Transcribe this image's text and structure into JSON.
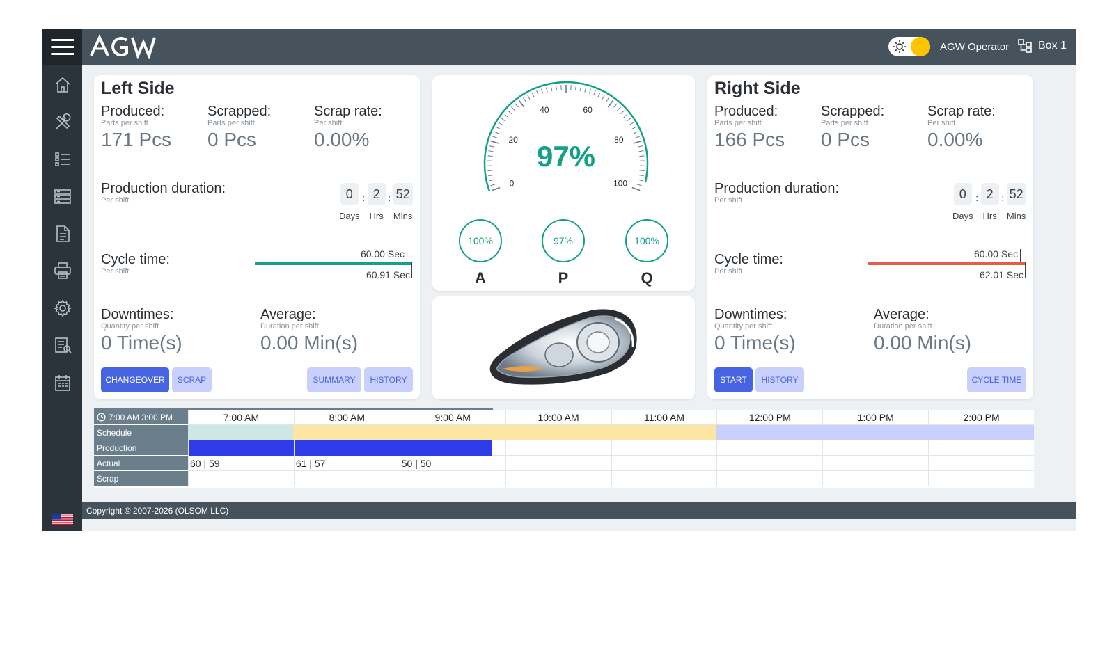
{
  "topbar": {
    "operator": "AGW Operator",
    "box": "Box 1"
  },
  "sidebar": {
    "items": [
      "home-icon",
      "tools-icon",
      "checklist-icon",
      "server-icon",
      "document-icon",
      "printer-icon",
      "gear-icon",
      "report-icon",
      "calendar-icon"
    ]
  },
  "left": {
    "title": "Left Side",
    "produced_label": "Produced:",
    "produced_sub": "Parts per shift",
    "produced_value": "171 Pcs",
    "scrapped_label": "Scrapped:",
    "scrapped_sub": "Parts per shift",
    "scrapped_value": "0 Pcs",
    "scrap_rate_label": "Scrap rate:",
    "scrap_rate_sub": "Per shift",
    "scrap_rate_value": "0.00%",
    "duration_label": "Production duration:",
    "duration_sub": "Per shift",
    "days": "0",
    "hrs": "2",
    "mins": "52",
    "days_cap": "Days",
    "hrs_cap": "Hrs",
    "mins_cap": "Mins",
    "cycle_label": "Cycle time:",
    "cycle_sub": "Per shift",
    "cycle_target": "60.00 Sec",
    "cycle_actual": "60.91 Sec",
    "cycle_color": "#14a08a",
    "downtimes_label": "Downtimes:",
    "downtimes_sub": "Quantity per shift",
    "downtimes_value": "0 Time(s)",
    "average_label": "Average:",
    "average_sub": "Duration per shift",
    "average_value": "0.00 Min(s)",
    "buttons": {
      "changeover": "CHANGEOVER",
      "scrap": "SCRAP",
      "summary": "SUMMARY",
      "history": "HISTORY"
    }
  },
  "right": {
    "title": "Right Side",
    "produced_label": "Produced:",
    "produced_sub": "Parts per shift",
    "produced_value": "166 Pcs",
    "scrapped_label": "Scrapped:",
    "scrapped_sub": "Parts per shift",
    "scrapped_value": "0 Pcs",
    "scrap_rate_label": "Scrap rate:",
    "scrap_rate_sub": "Per shift",
    "scrap_rate_value": "0.00%",
    "duration_label": "Production duration:",
    "duration_sub": "Per shift",
    "days": "0",
    "hrs": "2",
    "mins": "52",
    "days_cap": "Days",
    "hrs_cap": "Hrs",
    "mins_cap": "Mins",
    "cycle_label": "Cycle time:",
    "cycle_sub": "Per shift",
    "cycle_target": "60.00 Sec",
    "cycle_actual": "62.01 Sec",
    "cycle_color": "#ea5a4a",
    "downtimes_label": "Downtimes:",
    "downtimes_sub": "Quantity per shift",
    "downtimes_value": "0 Time(s)",
    "average_label": "Average:",
    "average_sub": "Duration per shift",
    "average_value": "0.00 Min(s)",
    "buttons": {
      "start": "START",
      "history": "HISTORY",
      "cycle_time": "CYCLE TIME"
    }
  },
  "gauge": {
    "value": "97%",
    "value_num": 97,
    "ticks": [
      "0",
      "20",
      "40",
      "60",
      "80",
      "100"
    ],
    "accent": "#14a08a",
    "kpis": [
      {
        "value": "100%",
        "letter": "A"
      },
      {
        "value": "97%",
        "letter": "P"
      },
      {
        "value": "100%",
        "letter": "Q"
      }
    ]
  },
  "timeline": {
    "range": "7:00 AM 3:00 PM",
    "hours": [
      "7:00 AM",
      "8:00 AM",
      "9:00 AM",
      "10:00 AM",
      "11:00 AM",
      "12:00 PM",
      "1:00 PM",
      "2:00 PM"
    ],
    "rows": {
      "schedule": "Schedule",
      "production": "Production",
      "actual": "Actual",
      "scrap": "Scrap"
    },
    "actual_values": [
      "60 | 59",
      "61 | 57",
      "50 | 50"
    ],
    "production_fill_hours": 2.88
  },
  "footer": {
    "copyright": "Copyright © 2007-2026 (OLSOM LLC)"
  }
}
